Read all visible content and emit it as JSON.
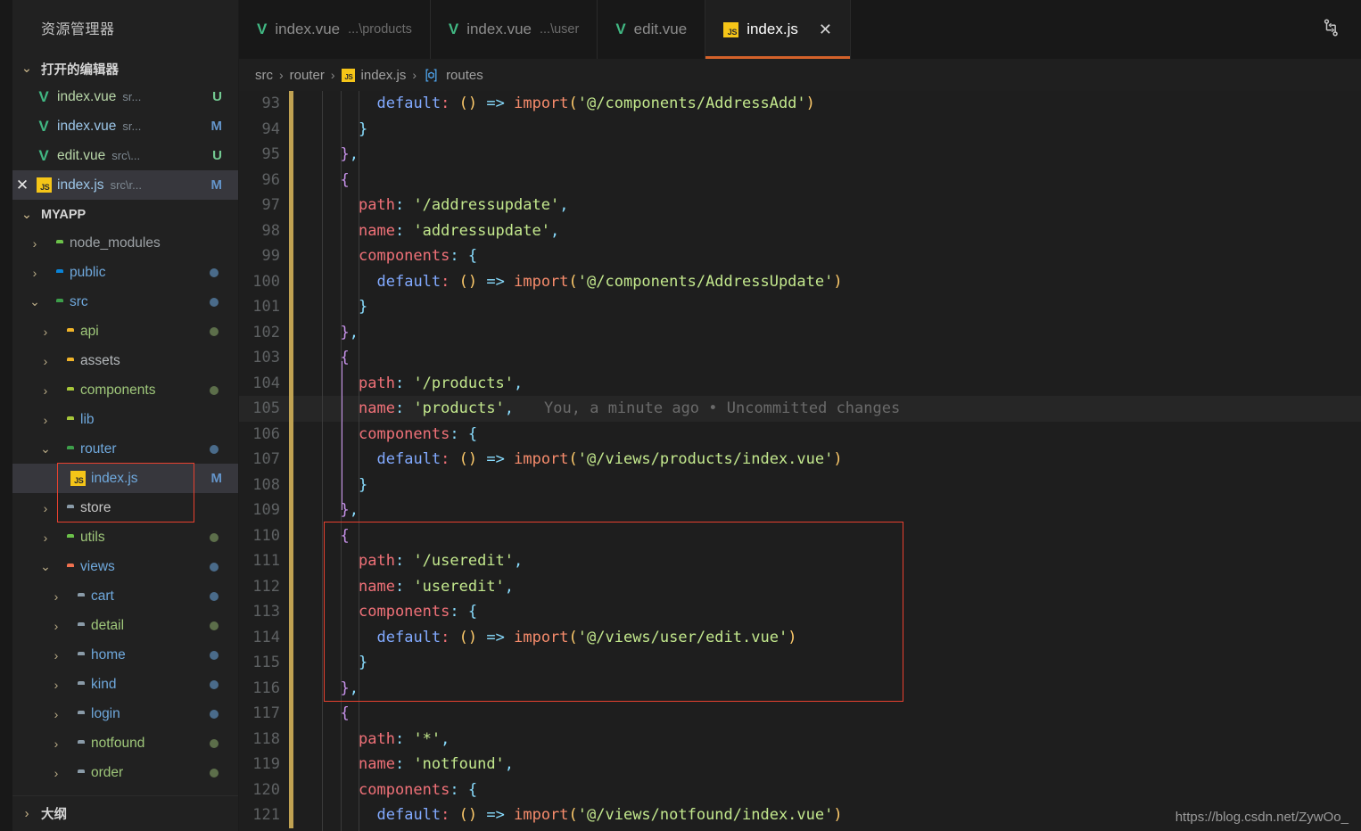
{
  "sidebar": {
    "title": "资源管理器",
    "open_editors": {
      "label": "打开的编辑器",
      "items": [
        {
          "name": "index.vue",
          "sub": "sr...",
          "badge": "U",
          "icon": "vue-icon",
          "badge_color": "#73c991",
          "selected": false,
          "closable": false
        },
        {
          "name": "index.vue",
          "sub": "sr...",
          "badge": "M",
          "icon": "vue-icon",
          "badge_color": "#6494c9",
          "selected": false,
          "closable": false
        },
        {
          "name": "edit.vue",
          "sub": "src\\...",
          "badge": "U",
          "icon": "vue-icon",
          "badge_color": "#73c991",
          "selected": false,
          "closable": false
        },
        {
          "name": "index.js",
          "sub": "src\\r...",
          "badge": "M",
          "icon": "js-icon",
          "badge_color": "#6494c9",
          "selected": true,
          "closable": true
        }
      ]
    },
    "workspace": {
      "label": "MYAPP",
      "items": [
        {
          "label": "node_modules",
          "indent": 0,
          "twisty": "chevron-right",
          "icon": "folder",
          "icon_color": "#6cc24a",
          "text_color": "#9da2a6",
          "dot": ""
        },
        {
          "label": "public",
          "indent": 0,
          "twisty": "chevron-right",
          "icon": "folder",
          "icon_color": "#0a84d8",
          "text_color": "#6fa8dc",
          "dot": "#4a6b8a"
        },
        {
          "label": "src",
          "indent": 0,
          "twisty": "chevron-down",
          "icon": "folder",
          "icon_color": "#3d9e4a",
          "text_color": "#6fa8dc",
          "dot": "#4a6b8a"
        },
        {
          "label": "api",
          "indent": 1,
          "twisty": "chevron-right",
          "icon": "folder",
          "icon_color": "#f0b429",
          "text_color": "#9fc77a",
          "dot": "#5c6e4a"
        },
        {
          "label": "assets",
          "indent": 1,
          "twisty": "chevron-right",
          "icon": "folder",
          "icon_color": "#f0b429",
          "text_color": "#b4b8bb",
          "dot": ""
        },
        {
          "label": "components",
          "indent": 1,
          "twisty": "chevron-right",
          "icon": "folder",
          "icon_color": "#a6c639",
          "text_color": "#9fc77a",
          "dot": "#5c6e4a"
        },
        {
          "label": "lib",
          "indent": 1,
          "twisty": "chevron-right",
          "icon": "folder",
          "icon_color": "#a6c639",
          "text_color": "#6fa8dc",
          "dot": ""
        },
        {
          "label": "router",
          "indent": 1,
          "twisty": "chevron-down",
          "icon": "folder",
          "icon_color": "#3d9e4a",
          "text_color": "#6fa8dc",
          "dot": "#4a6b8a"
        },
        {
          "label": "index.js",
          "indent": 2,
          "twisty": "none",
          "icon": "js",
          "icon_color": "#f5c518",
          "text_color": "#6fa8dc",
          "dot": "",
          "badge": "M",
          "badge_color": "#6494c9",
          "selected": true
        },
        {
          "label": "store",
          "indent": 1,
          "twisty": "chevron-right",
          "icon": "folder",
          "icon_color": "#8a9ba8",
          "text_color": "#c5c5c5",
          "dot": ""
        },
        {
          "label": "utils",
          "indent": 1,
          "twisty": "chevron-right",
          "icon": "folder",
          "icon_color": "#6cc24a",
          "text_color": "#9fc77a",
          "dot": "#5c6e4a"
        },
        {
          "label": "views",
          "indent": 1,
          "twisty": "chevron-down",
          "icon": "folder",
          "icon_color": "#f0714f",
          "text_color": "#6fa8dc",
          "dot": "#4a6b8a"
        },
        {
          "label": "cart",
          "indent": 2,
          "twisty": "chevron-right",
          "icon": "folder",
          "icon_color": "#8a9ba8",
          "text_color": "#6fa8dc",
          "dot": "#4a6b8a"
        },
        {
          "label": "detail",
          "indent": 2,
          "twisty": "chevron-right",
          "icon": "folder",
          "icon_color": "#8a9ba8",
          "text_color": "#9fc77a",
          "dot": "#5c6e4a"
        },
        {
          "label": "home",
          "indent": 2,
          "twisty": "chevron-right",
          "icon": "folder",
          "icon_color": "#8a9ba8",
          "text_color": "#6fa8dc",
          "dot": "#4a6b8a"
        },
        {
          "label": "kind",
          "indent": 2,
          "twisty": "chevron-right",
          "icon": "folder",
          "icon_color": "#8a9ba8",
          "text_color": "#6fa8dc",
          "dot": "#4a6b8a"
        },
        {
          "label": "login",
          "indent": 2,
          "twisty": "chevron-right",
          "icon": "folder",
          "icon_color": "#8a9ba8",
          "text_color": "#6fa8dc",
          "dot": "#4a6b8a"
        },
        {
          "label": "notfound",
          "indent": 2,
          "twisty": "chevron-right",
          "icon": "folder",
          "icon_color": "#8a9ba8",
          "text_color": "#9fc77a",
          "dot": "#5c6e4a"
        },
        {
          "label": "order",
          "indent": 2,
          "twisty": "chevron-right",
          "icon": "folder",
          "icon_color": "#8a9ba8",
          "text_color": "#9fc77a",
          "dot": "#5c6e4a"
        }
      ]
    },
    "outline_label": "大纲"
  },
  "tabs": [
    {
      "name": "index.vue",
      "sub": "...\\products",
      "icon": "vue-icon",
      "active": false,
      "closable": false
    },
    {
      "name": "index.vue",
      "sub": "...\\user",
      "icon": "vue-icon",
      "active": false,
      "closable": false
    },
    {
      "name": "edit.vue",
      "sub": "",
      "icon": "vue-icon",
      "active": false,
      "closable": false
    },
    {
      "name": "index.js",
      "sub": "",
      "icon": "js-icon",
      "active": true,
      "closable": true
    }
  ],
  "tabbar_actions": [
    {
      "name": "split-compare-icon",
      "glyph": "⑂"
    }
  ],
  "breadcrumb": [
    {
      "text": "src",
      "icon": ""
    },
    {
      "text": "router",
      "icon": ""
    },
    {
      "text": "index.js",
      "icon": "js-icon"
    },
    {
      "text": "routes",
      "icon": "symbol-array-icon"
    }
  ],
  "editor": {
    "active_tab_accent": "#d4622a",
    "first_line_number": 93,
    "blame_annotation": "You, a minute ago • Uncommitted changes",
    "lines": [
      {
        "n": 93,
        "indent": 3,
        "tokens": [
          [
            "t-prop",
            "default"
          ],
          [
            "t-key",
            ": "
          ],
          [
            "t-paren",
            "()"
          ],
          [
            "t-key",
            " "
          ],
          [
            "t-arrow",
            "=>"
          ],
          [
            "t-key",
            " "
          ],
          [
            "t-fn",
            "import"
          ],
          [
            "t-paren",
            "("
          ],
          [
            "t-str",
            "'@/components/AddressAdd'"
          ],
          [
            "t-paren",
            ")"
          ]
        ]
      },
      {
        "n": 94,
        "indent": 2,
        "tokens": [
          [
            "t-brace-c",
            "}"
          ]
        ]
      },
      {
        "n": 95,
        "indent": 1,
        "tokens": [
          [
            "t-brace-p",
            "}"
          ],
          [
            "t-comma",
            ","
          ]
        ]
      },
      {
        "n": 96,
        "indent": 1,
        "tokens": [
          [
            "t-brace-p",
            "{"
          ]
        ]
      },
      {
        "n": 97,
        "indent": 2,
        "tokens": [
          [
            "t-key",
            "path"
          ],
          [
            "t-punct",
            ": "
          ],
          [
            "t-str",
            "'/addressupdate'"
          ],
          [
            "t-comma",
            ","
          ]
        ]
      },
      {
        "n": 98,
        "indent": 2,
        "tokens": [
          [
            "t-key",
            "name"
          ],
          [
            "t-punct",
            ": "
          ],
          [
            "t-str",
            "'addressupdate'"
          ],
          [
            "t-comma",
            ","
          ]
        ]
      },
      {
        "n": 99,
        "indent": 2,
        "tokens": [
          [
            "t-key",
            "components"
          ],
          [
            "t-punct",
            ": "
          ],
          [
            "t-brace-c",
            "{"
          ]
        ]
      },
      {
        "n": 100,
        "indent": 3,
        "tokens": [
          [
            "t-prop",
            "default"
          ],
          [
            "t-key",
            ": "
          ],
          [
            "t-paren",
            "()"
          ],
          [
            "t-key",
            " "
          ],
          [
            "t-arrow",
            "=>"
          ],
          [
            "t-key",
            " "
          ],
          [
            "t-fn",
            "import"
          ],
          [
            "t-paren",
            "("
          ],
          [
            "t-str",
            "'@/components/AddressUpdate'"
          ],
          [
            "t-paren",
            ")"
          ]
        ]
      },
      {
        "n": 101,
        "indent": 2,
        "tokens": [
          [
            "t-brace-c",
            "}"
          ]
        ]
      },
      {
        "n": 102,
        "indent": 1,
        "tokens": [
          [
            "t-brace-p",
            "}"
          ],
          [
            "t-comma",
            ","
          ]
        ]
      },
      {
        "n": 103,
        "indent": 1,
        "tokens": [
          [
            "t-brace-p",
            "{"
          ]
        ]
      },
      {
        "n": 104,
        "indent": 2,
        "tokens": [
          [
            "t-key",
            "path"
          ],
          [
            "t-punct",
            ": "
          ],
          [
            "t-str",
            "'/products'"
          ],
          [
            "t-comma",
            ","
          ]
        ]
      },
      {
        "n": 105,
        "indent": 2,
        "highlight": true,
        "blame": true,
        "tokens": [
          [
            "t-key",
            "name"
          ],
          [
            "t-punct",
            ": "
          ],
          [
            "t-str",
            "'products'"
          ],
          [
            "t-comma",
            ","
          ]
        ]
      },
      {
        "n": 106,
        "indent": 2,
        "tokens": [
          [
            "t-key",
            "components"
          ],
          [
            "t-punct",
            ": "
          ],
          [
            "t-brace-c",
            "{"
          ]
        ]
      },
      {
        "n": 107,
        "indent": 3,
        "tokens": [
          [
            "t-prop",
            "default"
          ],
          [
            "t-key",
            ": "
          ],
          [
            "t-paren",
            "()"
          ],
          [
            "t-key",
            " "
          ],
          [
            "t-arrow",
            "=>"
          ],
          [
            "t-key",
            " "
          ],
          [
            "t-fn",
            "import"
          ],
          [
            "t-paren",
            "("
          ],
          [
            "t-str",
            "'@/views/products/index.vue'"
          ],
          [
            "t-paren",
            ")"
          ]
        ]
      },
      {
        "n": 108,
        "indent": 2,
        "tokens": [
          [
            "t-brace-c",
            "}"
          ]
        ]
      },
      {
        "n": 109,
        "indent": 1,
        "tokens": [
          [
            "t-brace-p",
            "}"
          ],
          [
            "t-comma",
            ","
          ]
        ]
      },
      {
        "n": 110,
        "indent": 1,
        "tokens": [
          [
            "t-brace-p",
            "{"
          ]
        ]
      },
      {
        "n": 111,
        "indent": 2,
        "tokens": [
          [
            "t-key",
            "path"
          ],
          [
            "t-punct",
            ": "
          ],
          [
            "t-str",
            "'/useredit'"
          ],
          [
            "t-comma",
            ","
          ]
        ]
      },
      {
        "n": 112,
        "indent": 2,
        "tokens": [
          [
            "t-key",
            "name"
          ],
          [
            "t-punct",
            ": "
          ],
          [
            "t-str",
            "'useredit'"
          ],
          [
            "t-comma",
            ","
          ]
        ]
      },
      {
        "n": 113,
        "indent": 2,
        "tokens": [
          [
            "t-key",
            "components"
          ],
          [
            "t-punct",
            ": "
          ],
          [
            "t-brace-c",
            "{"
          ]
        ]
      },
      {
        "n": 114,
        "indent": 3,
        "tokens": [
          [
            "t-prop",
            "default"
          ],
          [
            "t-key",
            ": "
          ],
          [
            "t-paren",
            "()"
          ],
          [
            "t-key",
            " "
          ],
          [
            "t-arrow",
            "=>"
          ],
          [
            "t-key",
            " "
          ],
          [
            "t-fn",
            "import"
          ],
          [
            "t-paren",
            "("
          ],
          [
            "t-str",
            "'@/views/user/edit.vue'"
          ],
          [
            "t-paren",
            ")"
          ]
        ]
      },
      {
        "n": 115,
        "indent": 2,
        "tokens": [
          [
            "t-brace-c",
            "}"
          ]
        ]
      },
      {
        "n": 116,
        "indent": 1,
        "tokens": [
          [
            "t-brace-p",
            "}"
          ],
          [
            "t-comma",
            ","
          ]
        ]
      },
      {
        "n": 117,
        "indent": 1,
        "tokens": [
          [
            "t-brace-p",
            "{"
          ]
        ]
      },
      {
        "n": 118,
        "indent": 2,
        "tokens": [
          [
            "t-key",
            "path"
          ],
          [
            "t-punct",
            ": "
          ],
          [
            "t-str",
            "'*'"
          ],
          [
            "t-comma",
            ","
          ]
        ]
      },
      {
        "n": 119,
        "indent": 2,
        "tokens": [
          [
            "t-key",
            "name"
          ],
          [
            "t-punct",
            ": "
          ],
          [
            "t-str",
            "'notfound'"
          ],
          [
            "t-comma",
            ","
          ]
        ]
      },
      {
        "n": 120,
        "indent": 2,
        "tokens": [
          [
            "t-key",
            "components"
          ],
          [
            "t-punct",
            ": "
          ],
          [
            "t-brace-c",
            "{"
          ]
        ]
      },
      {
        "n": 121,
        "indent": 3,
        "tokens": [
          [
            "t-prop",
            "default"
          ],
          [
            "t-key",
            ": "
          ],
          [
            "t-paren",
            "()"
          ],
          [
            "t-key",
            " "
          ],
          [
            "t-arrow",
            "=>"
          ],
          [
            "t-key",
            " "
          ],
          [
            "t-fn",
            "import"
          ],
          [
            "t-paren",
            "("
          ],
          [
            "t-str",
            "'@/views/notfound/index.vue'"
          ],
          [
            "t-paren",
            ")"
          ]
        ]
      }
    ]
  },
  "watermark": "https://blog.csdn.net/ZywOo_"
}
